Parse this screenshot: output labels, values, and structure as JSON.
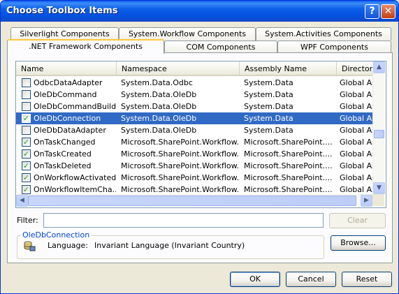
{
  "window": {
    "title": "Choose Toolbox Items"
  },
  "tabs": {
    "row1": [
      "Silverlight Components",
      "System.Workflow Components",
      "System.Activities Components"
    ],
    "row2": [
      ".NET Framework Components",
      "COM Components",
      "WPF Components"
    ],
    "active": ".NET Framework Components"
  },
  "list": {
    "columns": [
      "Name",
      "Namespace",
      "Assembly Name",
      "Directory"
    ],
    "rows": [
      {
        "checked": false,
        "selected": false,
        "name": "OdbcDataAdapter",
        "namespace": "System.Data.Odbc",
        "assembly": "System.Data",
        "directory": "Global Ass"
      },
      {
        "checked": false,
        "selected": false,
        "name": "OleDbCommand",
        "namespace": "System.Data.OleDb",
        "assembly": "System.Data",
        "directory": "Global Ass"
      },
      {
        "checked": false,
        "selected": false,
        "name": "OleDbCommandBuilder",
        "namespace": "System.Data.OleDb",
        "assembly": "System.Data",
        "directory": "Global Ass"
      },
      {
        "checked": true,
        "selected": true,
        "name": "OleDbConnection",
        "namespace": "System.Data.OleDb",
        "assembly": "System.Data",
        "directory": "Global Ass"
      },
      {
        "checked": false,
        "selected": false,
        "name": "OleDbDataAdapter",
        "namespace": "System.Data.OleDb",
        "assembly": "System.Data",
        "directory": "Global Ass"
      },
      {
        "checked": true,
        "selected": false,
        "name": "OnTaskChanged",
        "namespace": "Microsoft.SharePoint.Workflow...",
        "assembly": "Microsoft.SharePoint....",
        "directory": "Global Ass"
      },
      {
        "checked": true,
        "selected": false,
        "name": "OnTaskCreated",
        "namespace": "Microsoft.SharePoint.Workflow...",
        "assembly": "Microsoft.SharePoint....",
        "directory": "Global Ass"
      },
      {
        "checked": true,
        "selected": false,
        "name": "OnTaskDeleted",
        "namespace": "Microsoft.SharePoint.Workflow...",
        "assembly": "Microsoft.SharePoint....",
        "directory": "Global Ass"
      },
      {
        "checked": true,
        "selected": false,
        "name": "OnWorkflowActivated",
        "namespace": "Microsoft.SharePoint.Workflow...",
        "assembly": "Microsoft.SharePoint....",
        "directory": "Global Ass"
      },
      {
        "checked": true,
        "selected": false,
        "name": "OnWorkflowItemCha...",
        "namespace": "Microsoft.SharePoint.Workflow...",
        "assembly": "Microsoft.SharePoint....",
        "directory": "Global Ass"
      }
    ]
  },
  "filter": {
    "label": "Filter:",
    "value": "",
    "clear_label": "Clear"
  },
  "info": {
    "title": "OleDbConnection",
    "language_label": "Language:",
    "language_value": "Invariant Language (Invariant Country)",
    "icon": "database-component-icon"
  },
  "buttons": {
    "browse": "Browse...",
    "ok": "OK",
    "cancel": "Cancel",
    "reset": "Reset"
  },
  "colors": {
    "selection": "#316ac5",
    "titlebar": "#0552e0",
    "group_title": "#0046d5"
  }
}
